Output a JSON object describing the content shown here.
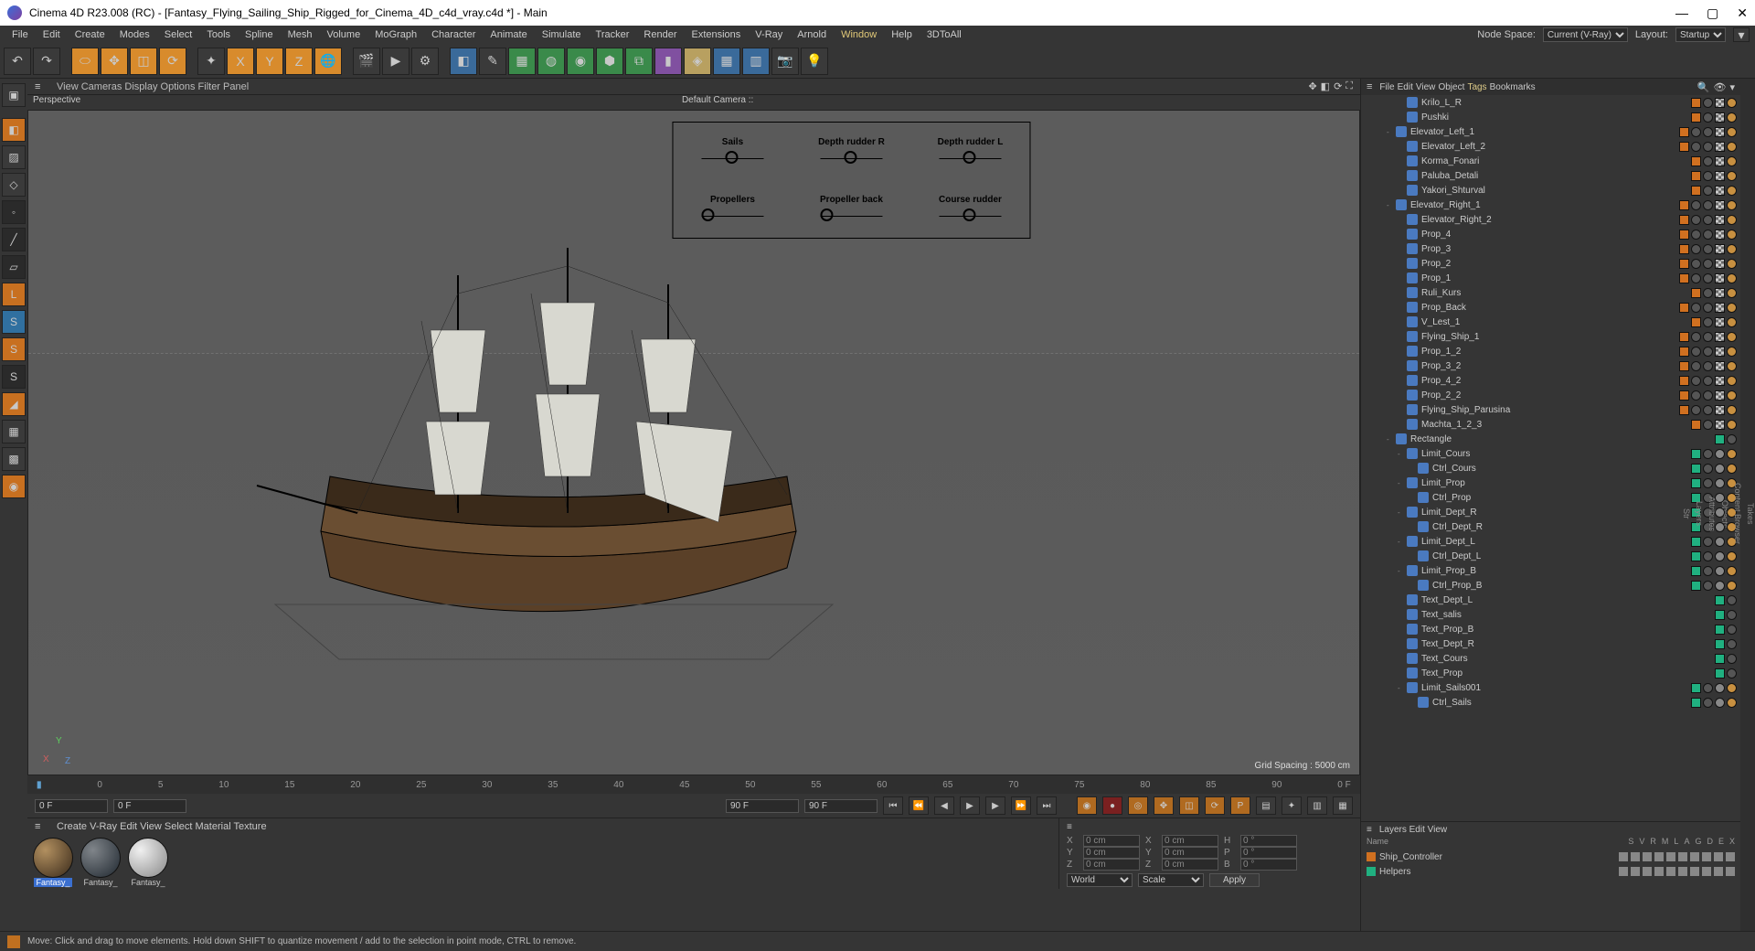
{
  "title": "Cinema 4D R23.008 (RC) - [Fantasy_Flying_Sailing_Ship_Rigged_for_Cinema_4D_c4d_vray.c4d *] - Main",
  "menubar": [
    "File",
    "Edit",
    "Create",
    "Modes",
    "Select",
    "Tools",
    "Spline",
    "Mesh",
    "Volume",
    "MoGraph",
    "Character",
    "Animate",
    "Simulate",
    "Tracker",
    "Render",
    "Extensions",
    "V-Ray",
    "Arnold",
    "Window",
    "Help",
    "3DToAll"
  ],
  "nodespace_label": "Node Space:",
  "nodespace_value": "Current (V-Ray)",
  "layout_label": "Layout:",
  "layout_value": "Startup",
  "vp_tabs": [
    "View",
    "Cameras",
    "Display",
    "Options",
    "Filter",
    "Panel"
  ],
  "vp_label": "Perspective",
  "vp_camera": "Default Camera ::",
  "overlay": {
    "r1": [
      "Sails",
      "Depth rudder R",
      "Depth rudder L"
    ],
    "r2": [
      "Propellers",
      "Propeller back",
      "Course rudder"
    ]
  },
  "grid_spacing": "Grid Spacing : 5000 cm",
  "timeline": {
    "ticks": [
      "0",
      "5",
      "10",
      "15",
      "20",
      "25",
      "30",
      "35",
      "40",
      "45",
      "50",
      "55",
      "60",
      "65",
      "70",
      "75",
      "80",
      "85",
      "90"
    ],
    "endlabel": "0 F",
    "start": "0 F",
    "start2": "0 F",
    "end": "90 F",
    "end2": "90 F"
  },
  "lower_tabs": [
    "Create",
    "V-Ray",
    "Edit",
    "View",
    "Select",
    "Material",
    "Texture"
  ],
  "materials": [
    {
      "name": "Fantasy_",
      "sel": true,
      "grad": "radial-gradient(circle at 30% 30%,#b29060,#3a2a1a)"
    },
    {
      "name": "Fantasy_",
      "grad": "radial-gradient(circle at 30% 30%,#80858a,#202830)"
    },
    {
      "name": "Fantasy_",
      "grad": "radial-gradient(circle at 30% 30%,#f0f0f0,#888)"
    }
  ],
  "obj_tabs_top": [
    "File",
    "Edit",
    "View",
    "Object",
    "Tags",
    "Bookmarks"
  ],
  "objects": [
    {
      "n": "Krilo_L_R",
      "d": 2,
      "c": "o",
      "t": [
        "o",
        "dot",
        "chk",
        "sun"
      ]
    },
    {
      "n": "Pushki",
      "d": 2,
      "c": "o",
      "t": [
        "o",
        "dot",
        "chk",
        "sun"
      ]
    },
    {
      "n": "Elevator_Left_1",
      "d": 1,
      "e": "-",
      "c": "o",
      "t": [
        "o",
        "dot",
        "dot",
        "chk",
        "sun"
      ]
    },
    {
      "n": "Elevator_Left_2",
      "d": 2,
      "c": "o",
      "t": [
        "o",
        "dot",
        "dot",
        "chk",
        "sun"
      ]
    },
    {
      "n": "Korma_Fonari",
      "d": 2,
      "c": "o",
      "t": [
        "o",
        "dot",
        "chk",
        "sun"
      ]
    },
    {
      "n": "Paluba_Detali",
      "d": 2,
      "c": "o",
      "t": [
        "o",
        "dot",
        "chk",
        "sun"
      ]
    },
    {
      "n": "Yakori_Shturval",
      "d": 2,
      "c": "o",
      "t": [
        "o",
        "dot",
        "chk",
        "sun"
      ]
    },
    {
      "n": "Elevator_Right_1",
      "d": 1,
      "e": "-",
      "c": "o",
      "t": [
        "o",
        "dot",
        "dot",
        "chk",
        "sun"
      ]
    },
    {
      "n": "Elevator_Right_2",
      "d": 2,
      "c": "o",
      "t": [
        "o",
        "dot",
        "dot",
        "chk",
        "sun"
      ]
    },
    {
      "n": "Prop_4",
      "d": 2,
      "c": "o",
      "t": [
        "o",
        "dot",
        "dot",
        "chk",
        "sun"
      ]
    },
    {
      "n": "Prop_3",
      "d": 2,
      "c": "o",
      "t": [
        "o",
        "dot",
        "dot",
        "chk",
        "sun"
      ]
    },
    {
      "n": "Prop_2",
      "d": 2,
      "c": "o",
      "t": [
        "o",
        "dot",
        "dot",
        "chk",
        "sun"
      ]
    },
    {
      "n": "Prop_1",
      "d": 2,
      "c": "o",
      "t": [
        "o",
        "dot",
        "dot",
        "chk",
        "sun"
      ]
    },
    {
      "n": "Ruli_Kurs",
      "d": 2,
      "c": "o",
      "t": [
        "o",
        "dot",
        "chk",
        "sun"
      ]
    },
    {
      "n": "Prop_Back",
      "d": 2,
      "c": "o",
      "t": [
        "o",
        "dot",
        "dot",
        "chk",
        "sun"
      ]
    },
    {
      "n": "V_Lest_1",
      "d": 2,
      "c": "o",
      "t": [
        "o",
        "dot",
        "chk",
        "sun"
      ]
    },
    {
      "n": "Flying_Ship_1",
      "d": 2,
      "c": "o",
      "t": [
        "o",
        "dot",
        "dot",
        "chk",
        "sun"
      ]
    },
    {
      "n": "Prop_1_2",
      "d": 2,
      "c": "o",
      "t": [
        "o",
        "dot",
        "dot",
        "chk",
        "sun"
      ]
    },
    {
      "n": "Prop_3_2",
      "d": 2,
      "c": "o",
      "t": [
        "o",
        "dot",
        "dot",
        "chk",
        "sun"
      ]
    },
    {
      "n": "Prop_4_2",
      "d": 2,
      "c": "o",
      "t": [
        "o",
        "dot",
        "dot",
        "chk",
        "sun"
      ]
    },
    {
      "n": "Prop_2_2",
      "d": 2,
      "c": "o",
      "t": [
        "o",
        "dot",
        "dot",
        "chk",
        "sun"
      ]
    },
    {
      "n": "Flying_Ship_Parusina",
      "d": 2,
      "c": "o",
      "t": [
        "o",
        "dot",
        "dot",
        "chk",
        "sun"
      ]
    },
    {
      "n": "Machta_1_2_3",
      "d": 2,
      "c": "o",
      "t": [
        "o",
        "dot",
        "chk",
        "sun"
      ]
    },
    {
      "n": "Rectangle",
      "d": 1,
      "e": "-",
      "c": "g",
      "t": [
        "g",
        "dot"
      ]
    },
    {
      "n": "Limit_Cours",
      "d": 2,
      "e": "-",
      "c": "g",
      "t": [
        "g",
        "dot",
        "no",
        "sun"
      ]
    },
    {
      "n": "Ctrl_Cours",
      "d": 3,
      "c": "g",
      "t": [
        "g",
        "dot",
        "no",
        "sun"
      ]
    },
    {
      "n": "Limit_Prop",
      "d": 2,
      "e": "-",
      "c": "g",
      "t": [
        "g",
        "dot",
        "no",
        "sun"
      ]
    },
    {
      "n": "Ctrl_Prop",
      "d": 3,
      "c": "g",
      "t": [
        "g",
        "dot",
        "no",
        "sun"
      ]
    },
    {
      "n": "Limit_Dept_R",
      "d": 2,
      "e": "-",
      "c": "g",
      "t": [
        "g",
        "dot",
        "no",
        "sun"
      ]
    },
    {
      "n": "Ctrl_Dept_R",
      "d": 3,
      "c": "g",
      "t": [
        "g",
        "dot",
        "no",
        "sun"
      ]
    },
    {
      "n": "Limit_Dept_L",
      "d": 2,
      "e": "-",
      "c": "g",
      "t": [
        "g",
        "dot",
        "no",
        "sun"
      ]
    },
    {
      "n": "Ctrl_Dept_L",
      "d": 3,
      "c": "g",
      "t": [
        "g",
        "dot",
        "no",
        "sun"
      ]
    },
    {
      "n": "Limit_Prop_B",
      "d": 2,
      "e": "-",
      "c": "g",
      "t": [
        "g",
        "dot",
        "no",
        "sun"
      ]
    },
    {
      "n": "Ctrl_Prop_B",
      "d": 3,
      "c": "g",
      "t": [
        "g",
        "dot",
        "no",
        "sun"
      ]
    },
    {
      "n": "Text_Dept_L",
      "d": 2,
      "c": "g",
      "t": [
        "g",
        "dot"
      ]
    },
    {
      "n": "Text_salis",
      "d": 2,
      "c": "g",
      "t": [
        "g",
        "dot"
      ]
    },
    {
      "n": "Text_Prop_B",
      "d": 2,
      "c": "g",
      "t": [
        "g",
        "dot"
      ]
    },
    {
      "n": "Text_Dept_R",
      "d": 2,
      "c": "g",
      "t": [
        "g",
        "dot"
      ]
    },
    {
      "n": "Text_Cours",
      "d": 2,
      "c": "g",
      "t": [
        "g",
        "dot"
      ]
    },
    {
      "n": "Text_Prop",
      "d": 2,
      "c": "g",
      "t": [
        "g",
        "dot"
      ]
    },
    {
      "n": "Limit_Sails001",
      "d": 2,
      "e": "-",
      "c": "g",
      "t": [
        "g",
        "dot",
        "no",
        "sun"
      ]
    },
    {
      "n": "Ctrl_Sails",
      "d": 3,
      "c": "g",
      "t": [
        "g",
        "dot",
        "no",
        "sun"
      ]
    }
  ],
  "layers": {
    "tabs": [
      "Layers",
      "Edit",
      "View"
    ],
    "name_h": "Name",
    "cols": [
      "S",
      "V",
      "R",
      "M",
      "L",
      "A",
      "G",
      "D",
      "E",
      "X"
    ],
    "rows": [
      {
        "n": "Ship_Controller",
        "c": "#d07020"
      },
      {
        "n": "Helpers",
        "c": "#20b080"
      }
    ]
  },
  "coords": {
    "rows": [
      {
        "a": "X",
        "v1": "0 cm",
        "b": "X",
        "v2": "0 cm",
        "c": "H",
        "v3": "0 °"
      },
      {
        "a": "Y",
        "v1": "0 cm",
        "b": "Y",
        "v2": "0 cm",
        "c": "P",
        "v3": "0 °"
      },
      {
        "a": "Z",
        "v1": "0 cm",
        "b": "Z",
        "v2": "0 cm",
        "c": "B",
        "v3": "0 °"
      }
    ],
    "world": "World",
    "scale": "Scale",
    "apply": "Apply"
  },
  "status": "Move: Click and drag to move elements. Hold down SHIFT to quantize movement / add to the selection in point mode, CTRL to remove.",
  "side_tabs": [
    "Takes",
    "Content Browser",
    "Objects",
    "Attributes",
    "Layers",
    "Str"
  ]
}
